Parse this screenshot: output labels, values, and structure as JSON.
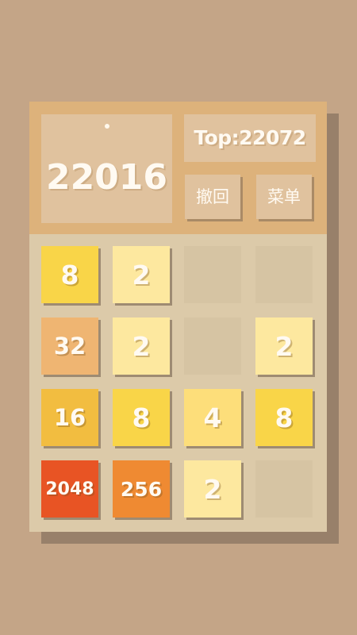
{
  "game": {
    "score": "22016",
    "top_score": "Top:22072",
    "undo_label": "撤回",
    "menu_label": "菜单"
  },
  "colors": {
    "background": "#c4a587",
    "header": "#ddb27b",
    "board": "#dccaa9",
    "empty_cell": "#d6c4a3"
  },
  "board": {
    "rows": [
      [
        "8",
        "2",
        "",
        ""
      ],
      [
        "32",
        "2",
        "",
        "2"
      ],
      [
        "16",
        "8",
        "4",
        "8"
      ],
      [
        "2048",
        "256",
        "2",
        ""
      ]
    ]
  },
  "tile_colors": {
    "2": "#fde89f",
    "4": "#fdde7a",
    "8": "#f9d548",
    "16": "#f2bd40",
    "32": "#efb572",
    "256": "#ef8a32",
    "2048": "#e85424"
  }
}
